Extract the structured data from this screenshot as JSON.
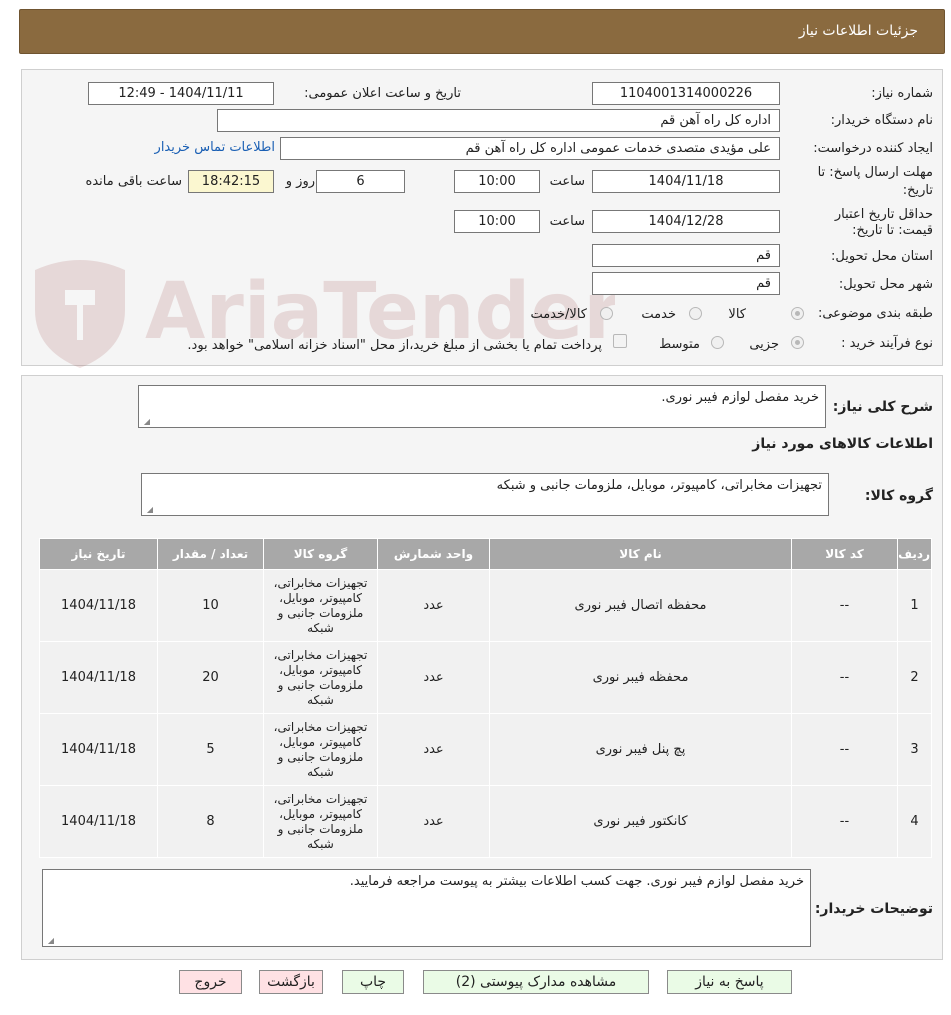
{
  "header": {
    "title": "جزئیات اطلاعات نیاز"
  },
  "form": {
    "need_number_label": "شماره نیاز:",
    "need_number": "1104001314000226",
    "announce_label": "تاریخ و ساعت اعلان عمومی:",
    "announce_value": "1404/11/11 - 12:49",
    "buyer_org_label": "نام دستگاه خریدار:",
    "buyer_org": "اداره کل  راه آهن قم",
    "requester_label": "ایجاد کننده درخواست:",
    "requester": "علی مؤیدی متصدی خدمات عمومی اداره کل  راه آهن قم",
    "contact_link": "اطلاعات تماس خریدار",
    "deadline_label_1": "مهلت ارسال پاسخ: تا",
    "deadline_label_2": "تاریخ:",
    "deadline_date": "1404/11/18",
    "time_label": "ساعت",
    "deadline_time": "10:00",
    "days_value": "6",
    "days_label": "روز و",
    "remaining_time": "18:42:15",
    "remaining_label": "ساعت باقی مانده",
    "validity_label_1": "حداقل تاریخ اعتبار",
    "validity_label_2": "قیمت: تا تاریخ:",
    "validity_date": "1404/12/28",
    "validity_time": "10:00",
    "province_label": "استان محل تحویل:",
    "province": "قم",
    "city_label": "شهر محل تحویل:",
    "city": "قم",
    "category_label": "طبقه بندی موضوعی:",
    "category_options": [
      "کالا",
      "خدمت",
      "کالا/خدمت"
    ],
    "process_label": "نوع فرآیند خرید :",
    "process_options": [
      "جزیی",
      "متوسط"
    ],
    "payment_note": "پرداخت تمام یا بخشی از مبلغ خرید،از محل \"اسناد خزانه اسلامی\" خواهد بود."
  },
  "summary": {
    "label": "شرح کلی نیاز:",
    "value": "خرید مفصل لوازم فیبر نوری."
  },
  "goods_section": {
    "title": "اطلاعات کالاهای مورد نیاز",
    "group_label": "گروه کالا:",
    "group_value": "تجهیزات مخابراتی، کامپیوتر، موبایل، ملزومات جانبی و شبکه"
  },
  "table": {
    "headers": [
      "ردیف",
      "کد کالا",
      "نام کالا",
      "واحد شمارش",
      "گروه کالا",
      "تعداد / مقدار",
      "تاریخ نیاز"
    ],
    "rows": [
      {
        "idx": "1",
        "code": "--",
        "name": "محفظه اتصال فیبر نوری",
        "unit": "عدد",
        "group": "تجهیزات مخابراتی، کامپیوتر، موبایل، ملزومات جانبی و شبکه",
        "qty": "10",
        "date": "1404/11/18"
      },
      {
        "idx": "2",
        "code": "--",
        "name": "محفظه فیبر نوری",
        "unit": "عدد",
        "group": "تجهیزات مخابراتی، کامپیوتر، موبایل، ملزومات جانبی و شبکه",
        "qty": "20",
        "date": "1404/11/18"
      },
      {
        "idx": "3",
        "code": "--",
        "name": "پچ پنل فیبر نوری",
        "unit": "عدد",
        "group": "تجهیزات مخابراتی، کامپیوتر، موبایل، ملزومات جانبی و شبکه",
        "qty": "5",
        "date": "1404/11/18"
      },
      {
        "idx": "4",
        "code": "--",
        "name": "کانکتور فیبر نوری",
        "unit": "عدد",
        "group": "تجهیزات مخابراتی، کامپیوتر، موبایل، ملزومات جانبی و شبکه",
        "qty": "8",
        "date": "1404/11/18"
      }
    ]
  },
  "buyer_notes": {
    "label": "توضیحات خریدار:",
    "value": "خرید مفصل لوازم فیبر نوری. جهت کسب اطلاعات بیشتر به پیوست مراجعه فرمایید."
  },
  "buttons": {
    "reply": "پاسخ به نیاز",
    "attachments": "مشاهده مدارک پیوستی (2)",
    "print": "چاپ",
    "back": "بازگشت",
    "exit": "خروج"
  },
  "watermark": {
    "text": "AriaTender.neT"
  },
  "colors": {
    "header_bg": "#8a6a3f",
    "link": "#1a5fb4",
    "table_header": "#a8a8a8",
    "green_button": "#eafbe6",
    "pink_button": "#ffe1e4"
  }
}
